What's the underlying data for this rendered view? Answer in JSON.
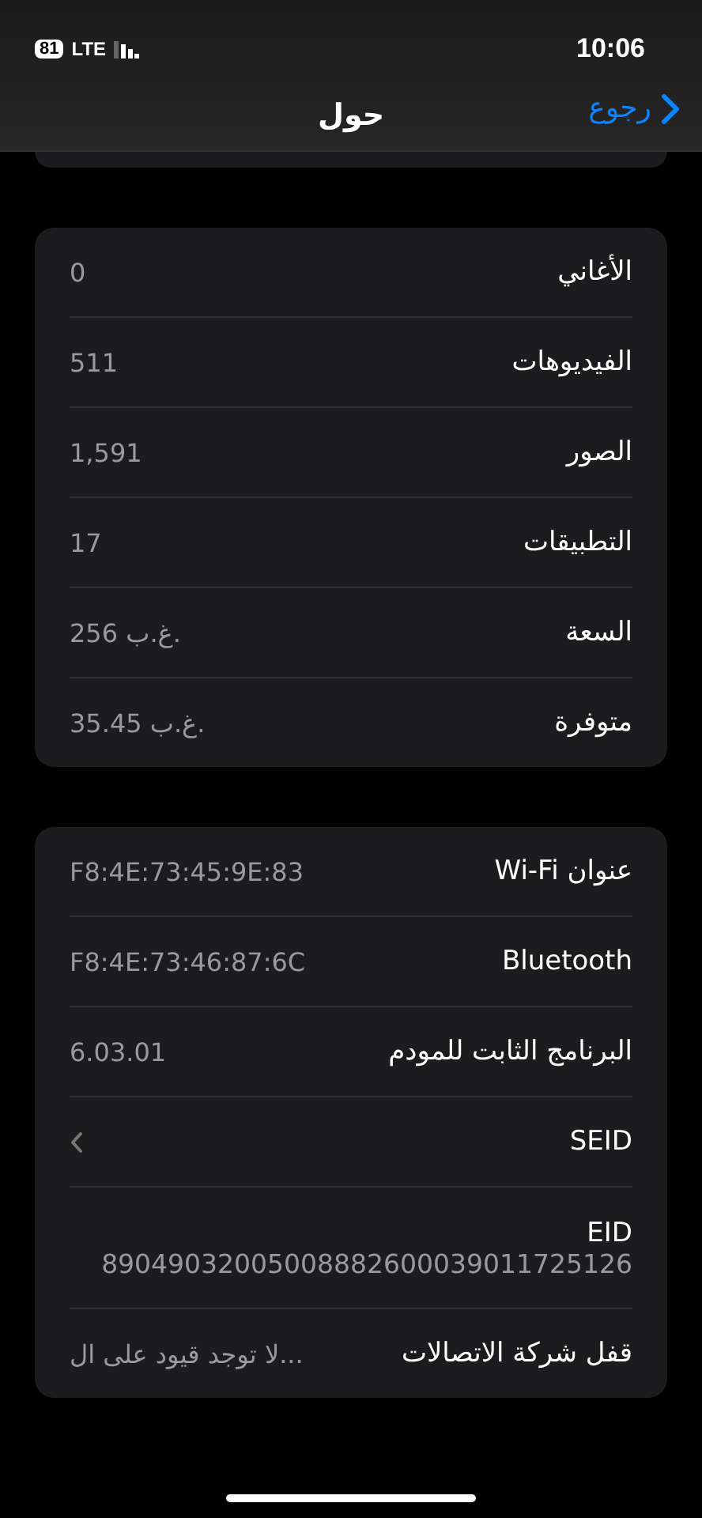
{
  "status_bar": {
    "battery": "81",
    "network": "LTE",
    "time": "10:06"
  },
  "nav": {
    "back": "رجوع",
    "title": "حول"
  },
  "sections": [
    {
      "rows": [
        {
          "kind": "value",
          "label": "الأغاني",
          "value": "0"
        },
        {
          "kind": "value",
          "label": "الفيديوهات",
          "value": "511"
        },
        {
          "kind": "value",
          "label": "الصور",
          "value": "1,591"
        },
        {
          "kind": "value",
          "label": "التطبيقات",
          "value": "17"
        },
        {
          "kind": "value",
          "label": "السعة",
          "value": "256 غ.ب."
        },
        {
          "kind": "value",
          "label": "متوفرة",
          "value": "35.45 غ.ب."
        }
      ]
    },
    {
      "rows": [
        {
          "kind": "value",
          "label": "عنوان Wi-Fi",
          "value": "F8:4E:73:45:9E:83"
        },
        {
          "kind": "value",
          "label": "Bluetooth",
          "value": "F8:4E:73:46:87:6C"
        },
        {
          "kind": "value",
          "label": "البرنامج الثابت للمودم",
          "value": "6.03.01"
        },
        {
          "kind": "link",
          "label": "SEID"
        },
        {
          "kind": "stacked",
          "label": "EID",
          "value": "89049032005008882600039011725126"
        },
        {
          "kind": "value",
          "label": "قفل شركة الاتصالات",
          "value": "لا توجد قيود على ال..."
        }
      ]
    }
  ]
}
